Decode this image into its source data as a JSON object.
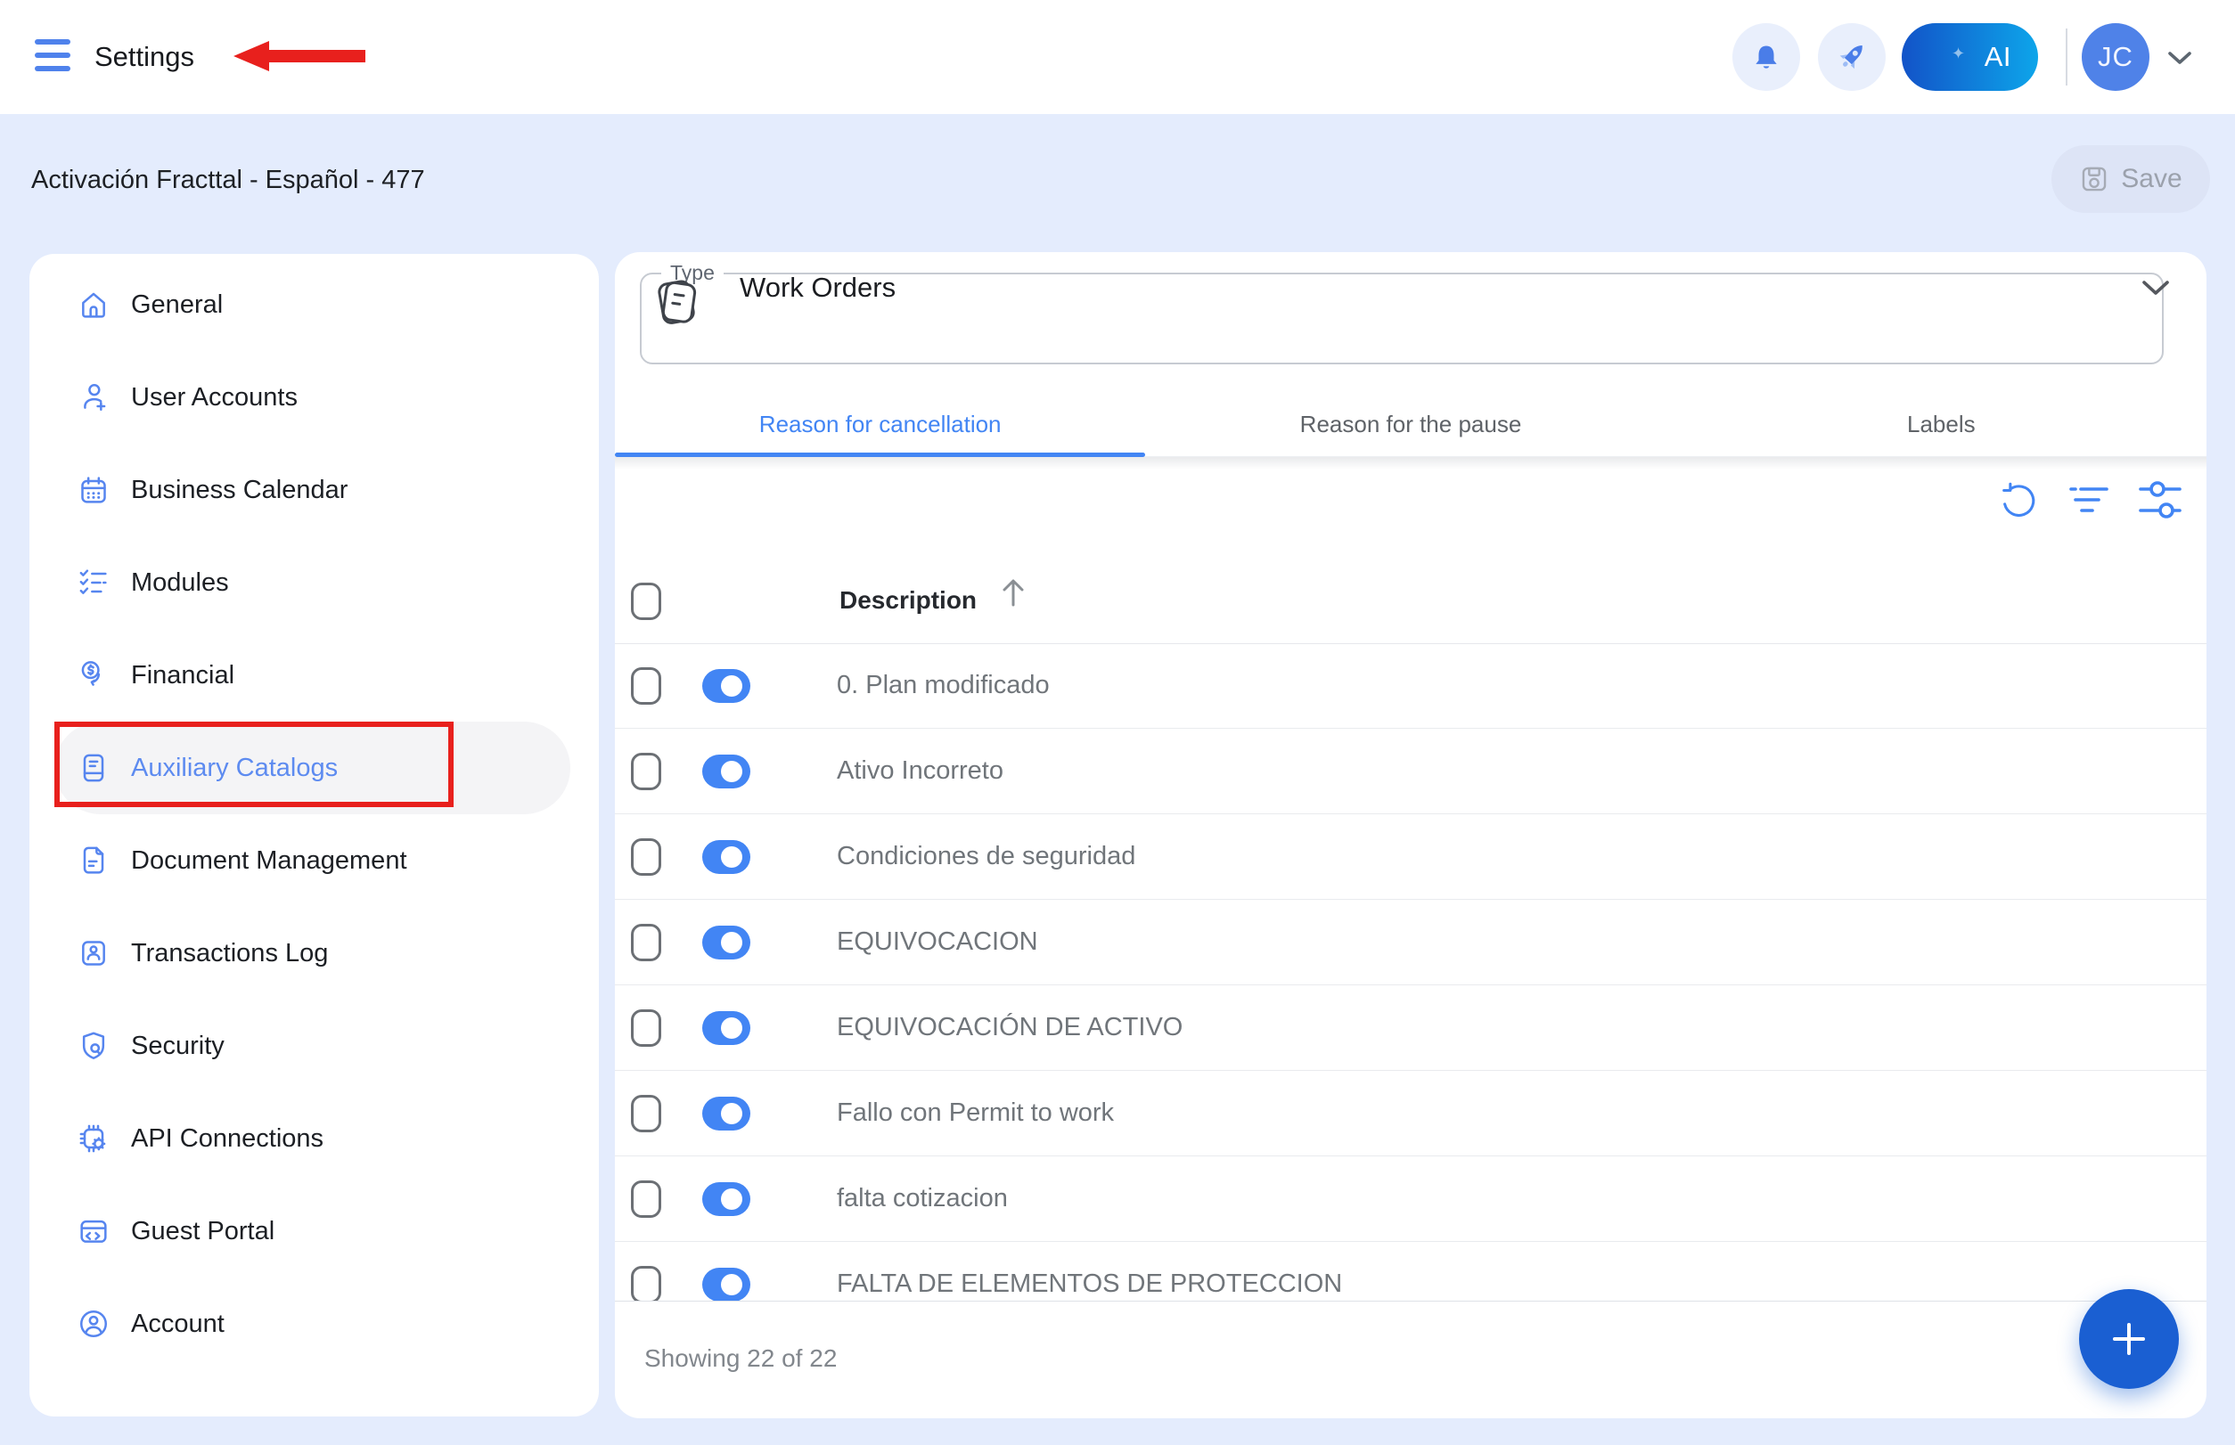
{
  "topbar": {
    "title": "Settings",
    "ai_button_label": "AI",
    "avatar_initials": "JC",
    "icons": [
      "hamburger-icon",
      "bell-icon",
      "rocket-icon",
      "chevron-down-icon"
    ]
  },
  "subheader": {
    "breadcrumb": "Activación Fracttal - Español - 477",
    "save_label": "Save"
  },
  "sidebar": {
    "items": [
      {
        "label": "General",
        "icon": "home-icon",
        "active": false
      },
      {
        "label": "User Accounts",
        "icon": "user-add-icon",
        "active": false
      },
      {
        "label": "Business Calendar",
        "icon": "calendar-icon",
        "active": false
      },
      {
        "label": "Modules",
        "icon": "checklist-icon",
        "active": false
      },
      {
        "label": "Financial",
        "icon": "coin-icon",
        "active": false
      },
      {
        "label": "Auxiliary Catalogs",
        "icon": "catalog-book-icon",
        "active": true
      },
      {
        "label": "Document Management",
        "icon": "document-icon",
        "active": false
      },
      {
        "label": "Transactions Log",
        "icon": "transactions-icon",
        "active": false
      },
      {
        "label": "Security",
        "icon": "shield-icon",
        "active": false
      },
      {
        "label": "API Connections",
        "icon": "chip-gear-icon",
        "active": false
      },
      {
        "label": "Guest Portal",
        "icon": "portal-window-icon",
        "active": false
      },
      {
        "label": "Account",
        "icon": "account-circle-icon",
        "active": false
      }
    ]
  },
  "main": {
    "type_field": {
      "label": "Type",
      "value": "Work Orders",
      "icon": "work-order-icon"
    },
    "tabs": [
      {
        "label": "Reason for cancellation",
        "active": true
      },
      {
        "label": "Reason for the pause",
        "active": false
      },
      {
        "label": "Labels",
        "active": false
      }
    ],
    "toolbar_icons": [
      "refresh-icon",
      "filter-icon",
      "tune-icon"
    ],
    "table": {
      "column_header": "Description",
      "sort_direction": "ascending",
      "rows": [
        {
          "description": "0. Plan modificado",
          "enabled": true
        },
        {
          "description": "Ativo Incorreto",
          "enabled": true
        },
        {
          "description": "Condiciones de seguridad",
          "enabled": true
        },
        {
          "description": "EQUIVOCACION",
          "enabled": true
        },
        {
          "description": "EQUIVOCACIÓN DE ACTIVO",
          "enabled": true
        },
        {
          "description": "Fallo con Permit to work",
          "enabled": true
        },
        {
          "description": "falta cotizacion",
          "enabled": true
        },
        {
          "description": "FALTA DE ELEMENTOS DE PROTECCION",
          "enabled": true
        }
      ],
      "footer": "Showing 22 of 22"
    }
  },
  "colors": {
    "page_bg": "#e4ecfd",
    "accent": "#4285f4",
    "sidebar_icon_blue": "#5685ef",
    "fab_blue": "#1a5fd2",
    "annotation_red": "#e8201d",
    "toggle_on": "#4285f4"
  }
}
